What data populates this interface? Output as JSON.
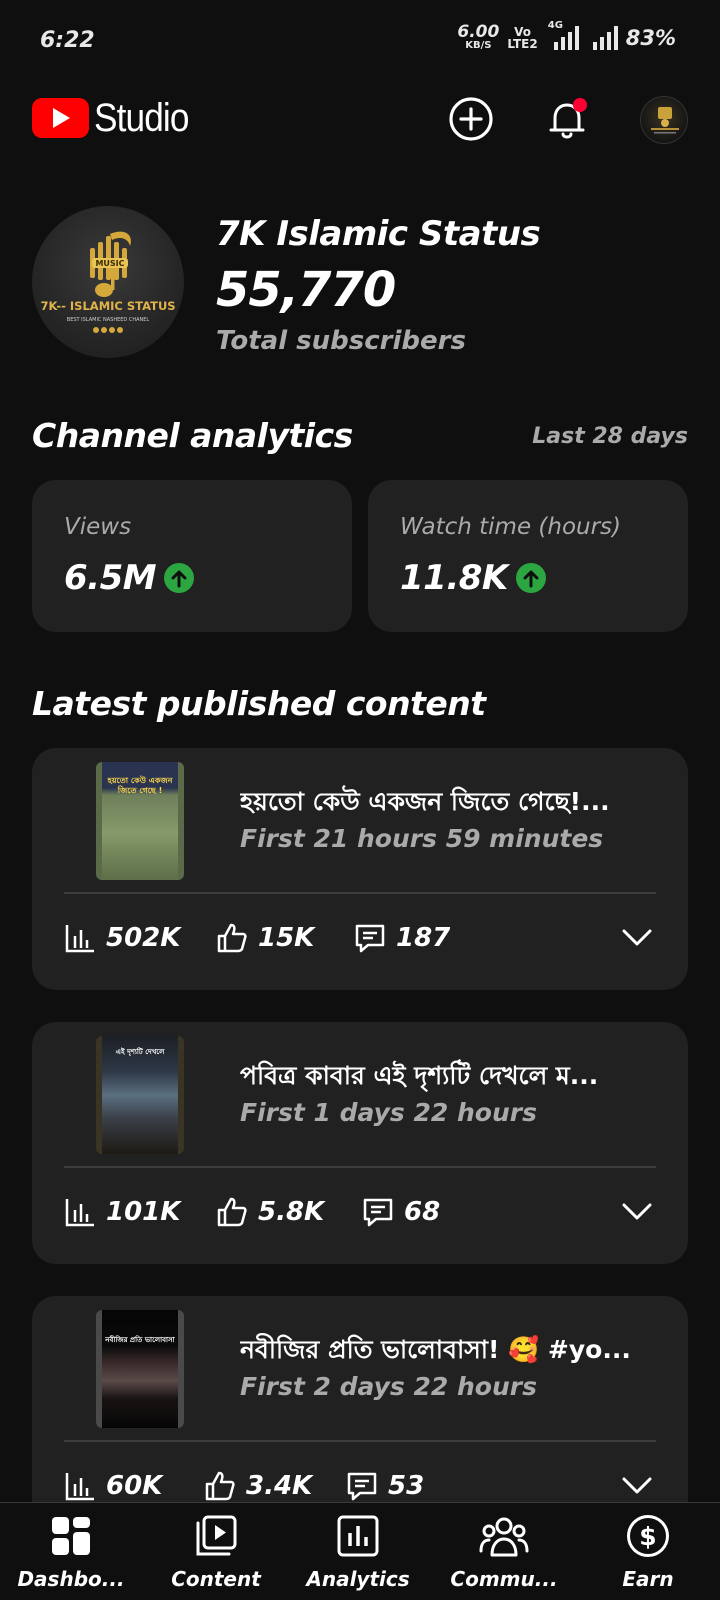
{
  "status_bar": {
    "time": "6:22",
    "net_speed": "6.00",
    "net_unit": "KB/S",
    "volte_top": "Vo",
    "volte_bottom": "LTE2",
    "network": "4G",
    "battery": "83%"
  },
  "header": {
    "app_name": "Studio",
    "brand_color": "#ff0000",
    "notification_dot_color": "#ff0033"
  },
  "channel": {
    "name": "7K Islamic Status",
    "subscribers": "55,770",
    "subscribers_label": "Total subscribers",
    "avatar_text_main": "7K-- ISLAMIC STATUS",
    "avatar_text_sub": "BEST ISLAMIC NASHEED CHANEL",
    "avatar_badge": "MUSIC"
  },
  "analytics": {
    "title": "Channel analytics",
    "range": "Last 28 days",
    "up_color": "#2ba640",
    "stats": [
      {
        "label": "Views",
        "value": "6.5M",
        "trend": "up"
      },
      {
        "label": "Watch time (hours)",
        "value": "11.8K",
        "trend": "up"
      }
    ]
  },
  "latest": {
    "title": "Latest published content",
    "items": [
      {
        "title": "হয়তো কেউ একজন জিতে গেছে!...",
        "period": "First 21 hours 59 minutes",
        "views": "502K",
        "likes": "15K",
        "comments": "187",
        "thumb_caption": "হয়তো কেউ একজন জিতে গেছে !"
      },
      {
        "title": "পবিত্র কাবার এই দৃশ্যটি দেখলে ম...",
        "period": "First 1 days 22 hours",
        "views": "101K",
        "likes": "5.8K",
        "comments": "68",
        "thumb_caption": "এই দৃশ্যটি দেখলে"
      },
      {
        "title": "নবীজির প্রতি ভালোবাসা! 🥰 #yo...",
        "period": "First 2 days 22 hours",
        "views": "60K",
        "likes": "3.4K",
        "comments": "53",
        "thumb_caption": "নবীজির প্রতি ভালোবাসা"
      }
    ]
  },
  "nav": [
    {
      "label": "Dashbo...",
      "icon": "dashboard-icon"
    },
    {
      "label": "Content",
      "icon": "content-icon"
    },
    {
      "label": "Analytics",
      "icon": "analytics-icon"
    },
    {
      "label": "Commu...",
      "icon": "community-icon"
    },
    {
      "label": "Earn",
      "icon": "earn-icon"
    }
  ]
}
